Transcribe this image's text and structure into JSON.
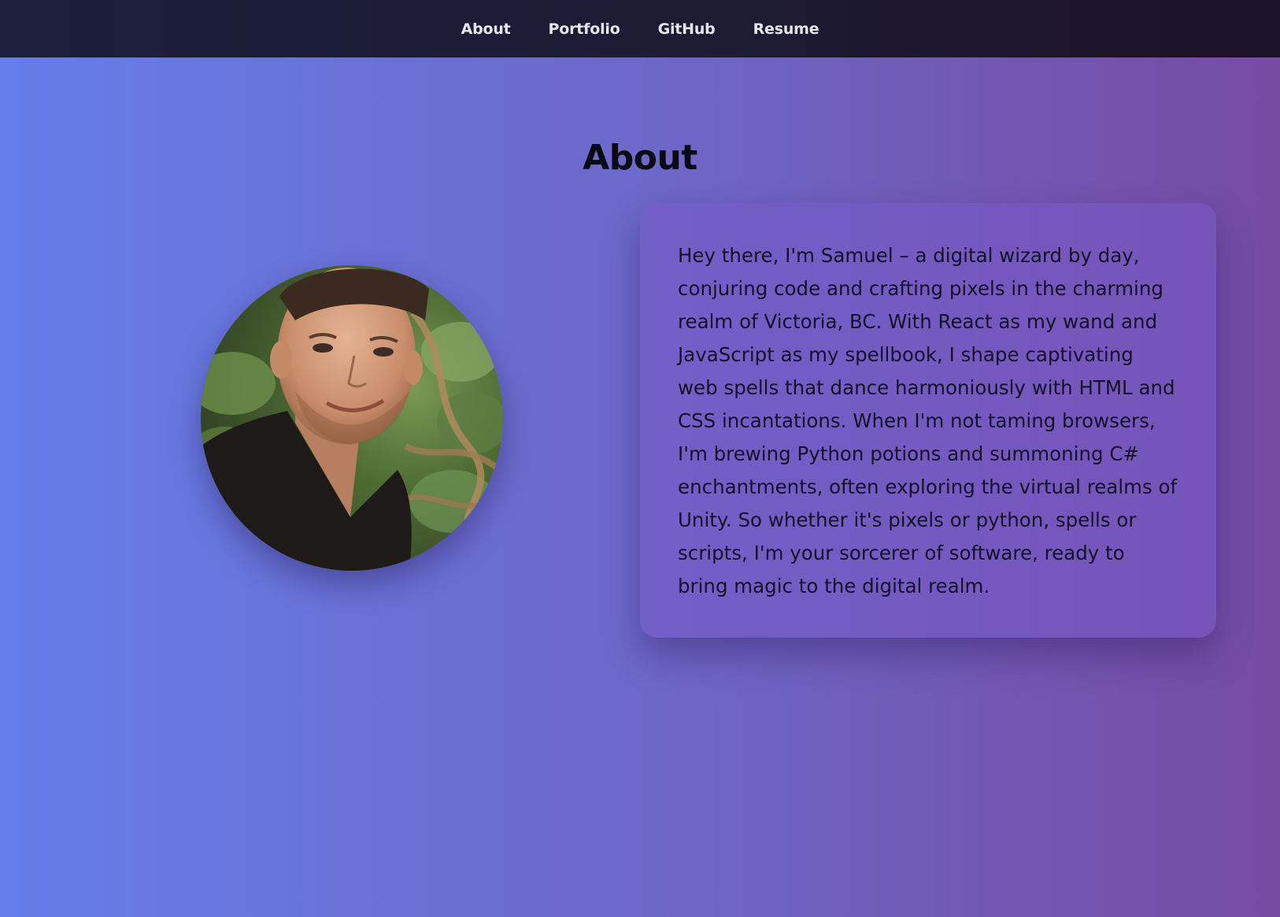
{
  "nav": {
    "items": [
      {
        "label": "About"
      },
      {
        "label": "Portfolio"
      },
      {
        "label": "GitHub"
      },
      {
        "label": "Resume"
      }
    ]
  },
  "main": {
    "title": "About",
    "avatar_icon": "profile-photo",
    "bio": "Hey there, I'm Samuel – a digital wizard by day, conjuring code and crafting pixels in the charming realm of Victoria, BC. With React as my wand and JavaScript as my spellbook, I shape captivating web spells that dance harmoniously with HTML and CSS incantations. When I'm not taming browsers, I'm brewing Python potions and summoning C# enchantments, often exploring the virtual realms of Unity. So whether it's pixels or python, spells or scripts, I'm your sorcerer of software, ready to bring magic to the digital realm."
  },
  "colors": {
    "gradient_start": "#667eea",
    "gradient_end": "#764ba2",
    "navbar_bg": "#1b1f3b",
    "nav_text": "#e6e6ef",
    "title_text": "#0a0a14"
  }
}
